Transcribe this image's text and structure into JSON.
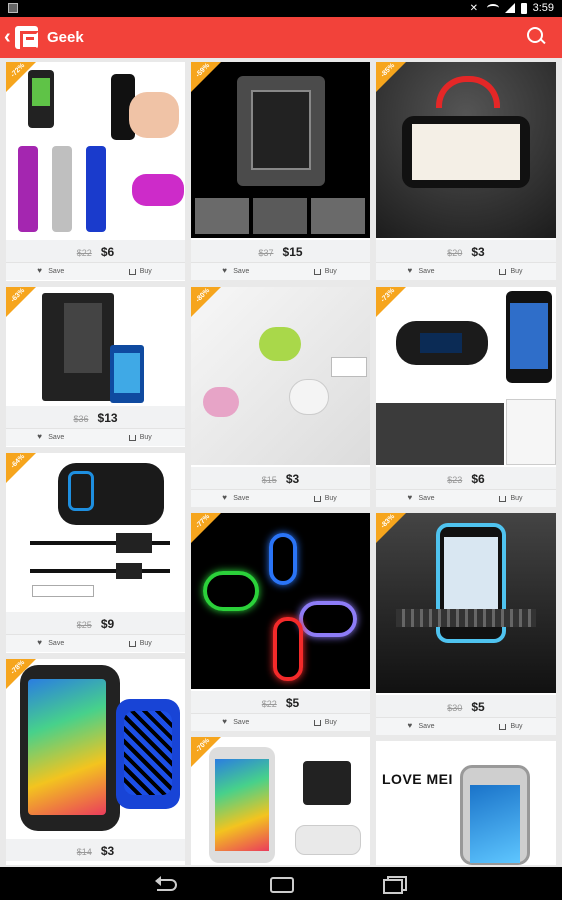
{
  "status_bar": {
    "time": "3:59"
  },
  "app_bar": {
    "title": "Geek"
  },
  "actions": {
    "save_label": "Save",
    "buy_label": "Buy"
  },
  "products": [
    {
      "discount": "-72%",
      "old_price": "$22",
      "price": "$6",
      "image": "power-bank-set"
    },
    {
      "discount": "-59%",
      "old_price": "$37",
      "price": "$15",
      "image": "rugged-metal-phone-case"
    },
    {
      "discount": "-85%",
      "old_price": "$20",
      "price": "$3",
      "image": "steering-wheel-phone-mount"
    },
    {
      "discount": "-63%",
      "old_price": "$36",
      "price": "$13",
      "image": "wallet-phone-case"
    },
    {
      "discount": "-80%",
      "old_price": "$15",
      "price": "$3",
      "image": "cable-clips"
    },
    {
      "discount": "-73%",
      "old_price": "$23",
      "price": "$6",
      "image": "fm-transmitter"
    },
    {
      "discount": "-64%",
      "old_price": "$25",
      "price": "$9",
      "image": "usb-car-charger"
    },
    {
      "discount": "-77%",
      "old_price": "$22",
      "price": "$5",
      "image": "glowing-usb-cables"
    },
    {
      "discount": "-83%",
      "old_price": "$30",
      "price": "$5",
      "image": "vent-phone-mount"
    },
    {
      "discount": "-78%",
      "old_price": "$14",
      "price": "$3",
      "image": "sport-armband"
    },
    {
      "discount": "-70%",
      "old_price": "",
      "price": "",
      "image": "phone-stand"
    },
    {
      "discount": "",
      "old_price": "",
      "price": "",
      "image": "love-mei-case",
      "brand_text": "LOVE MEI"
    }
  ],
  "colors": {
    "app_bar": "#f2423a",
    "badge": "#f6a51d"
  }
}
